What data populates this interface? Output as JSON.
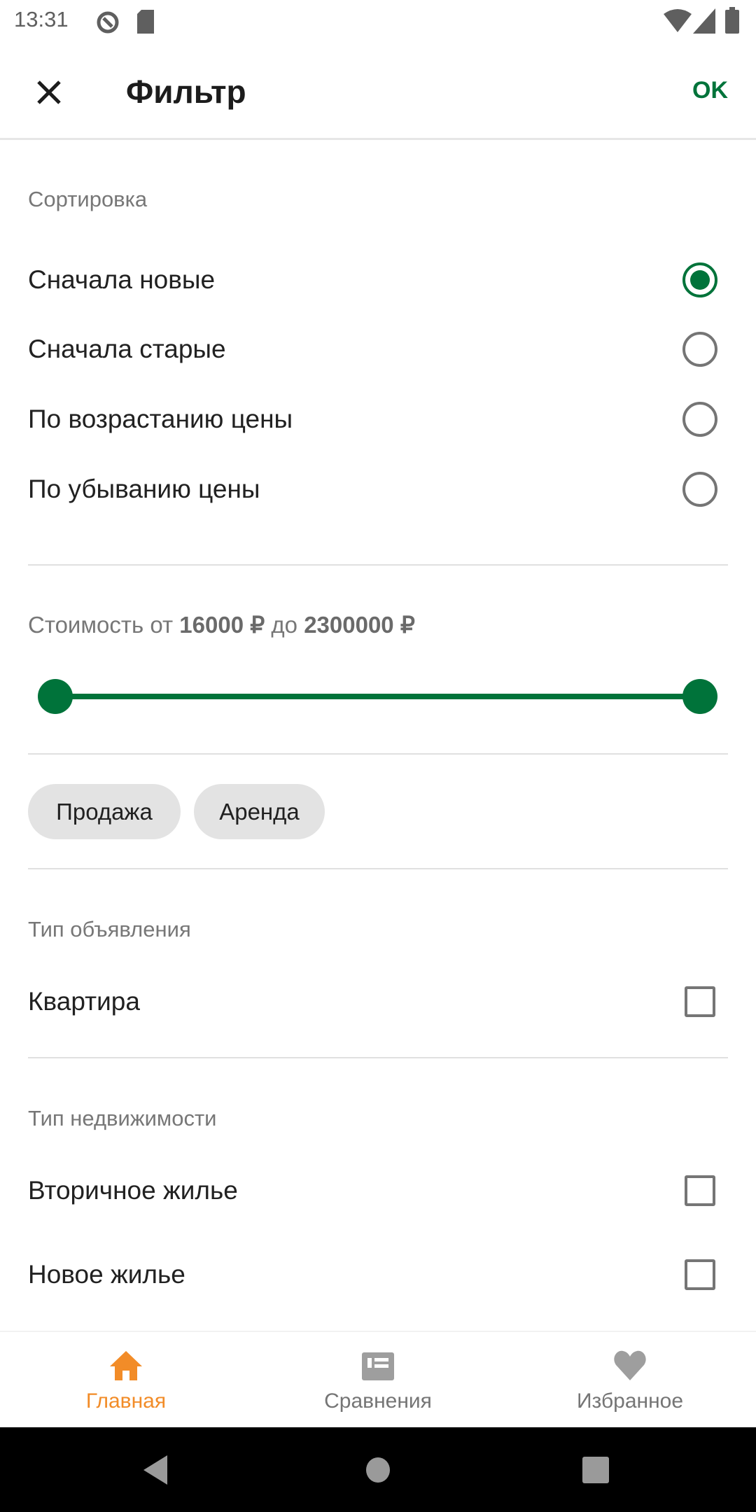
{
  "status": {
    "time": "13:31"
  },
  "header": {
    "title": "Фильтр",
    "ok": "OK"
  },
  "sort": {
    "label": "Сортировка",
    "options": [
      {
        "label": "Сначала новые",
        "selected": true
      },
      {
        "label": "Сначала старые",
        "selected": false
      },
      {
        "label": "По возрастанию цены",
        "selected": false
      },
      {
        "label": "По убыванию цены",
        "selected": false
      }
    ]
  },
  "price": {
    "prefix": "Стоимость от",
    "min": "16000 ₽",
    "mid": "до",
    "max": "2300000 ₽",
    "range_low_fraction": 0,
    "range_high_fraction": 1
  },
  "deal": {
    "chips": [
      "Продажа",
      "Аренда"
    ]
  },
  "ad_type": {
    "label": "Тип объявления",
    "options": [
      {
        "label": "Квартира",
        "checked": false
      }
    ]
  },
  "property_type": {
    "label": "Тип недвижимости",
    "options": [
      {
        "label": "Вторичное жилье",
        "checked": false
      },
      {
        "label": "Новое жилье",
        "checked": false
      }
    ]
  },
  "bottom_nav": {
    "items": [
      {
        "label": "Главная",
        "active": true
      },
      {
        "label": "Сравнения",
        "active": false
      },
      {
        "label": "Избранное",
        "active": false
      }
    ]
  },
  "colors": {
    "accent": "#00733a",
    "nav_active": "#f28c28",
    "inactive": "#9e9e9e"
  }
}
